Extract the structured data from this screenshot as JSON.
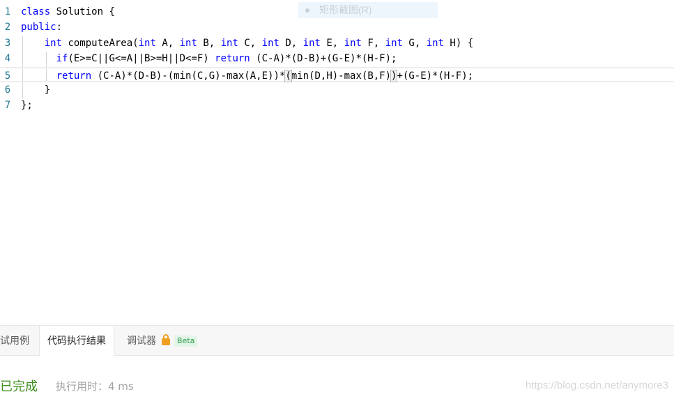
{
  "editor": {
    "line_numbers": [
      "1",
      "2",
      "3",
      "4",
      "5",
      "6",
      "7"
    ],
    "lines": [
      {
        "segments": [
          {
            "t": "class",
            "k": true
          },
          {
            "t": " Solution {",
            "k": false
          }
        ]
      },
      {
        "segments": [
          {
            "t": "public",
            "k": true
          },
          {
            "t": ":",
            "k": false
          }
        ]
      },
      {
        "segments": [
          {
            "t": "    ",
            "k": false
          },
          {
            "t": "int",
            "k": true
          },
          {
            "t": " computeArea(",
            "k": false
          },
          {
            "t": "int",
            "k": true
          },
          {
            "t": " A, ",
            "k": false
          },
          {
            "t": "int",
            "k": true
          },
          {
            "t": " B, ",
            "k": false
          },
          {
            "t": "int",
            "k": true
          },
          {
            "t": " C, ",
            "k": false
          },
          {
            "t": "int",
            "k": true
          },
          {
            "t": " D, ",
            "k": false
          },
          {
            "t": "int",
            "k": true
          },
          {
            "t": " E, ",
            "k": false
          },
          {
            "t": "int",
            "k": true
          },
          {
            "t": " F, ",
            "k": false
          },
          {
            "t": "int",
            "k": true
          },
          {
            "t": " G, ",
            "k": false
          },
          {
            "t": "int",
            "k": true
          },
          {
            "t": " H) {",
            "k": false
          }
        ]
      },
      {
        "segments": [
          {
            "t": "      ",
            "k": false
          },
          {
            "t": "if",
            "k": true
          },
          {
            "t": "(E>=C||G<=A||B>=H||D<=F) ",
            "k": false
          },
          {
            "t": "return",
            "k": true
          },
          {
            "t": " (C-A)*(D-B)+(G-E)*(H-F);",
            "k": false
          }
        ]
      },
      {
        "segments": [
          {
            "t": "      ",
            "k": false
          },
          {
            "t": "return",
            "k": true
          },
          {
            "t": " (C-A)*(D-B)-(min(C,G)-max(A,E))*",
            "k": false
          },
          {
            "t": "(",
            "k": false,
            "b": true
          },
          {
            "t": "min(D,H)-max(B,F)",
            "k": false
          },
          {
            "t": ")",
            "k": false,
            "b": true
          },
          {
            "t": "+(G-E)*(H-F);",
            "k": false
          }
        ]
      },
      {
        "segments": [
          {
            "t": "    }",
            "k": false
          }
        ]
      },
      {
        "segments": [
          {
            "t": "};",
            "k": false
          }
        ]
      }
    ]
  },
  "overlay": {
    "screenshot_hint": "矩形截图(R)"
  },
  "tabs": {
    "testcase_label": "试用例",
    "result_label": "代码执行结果",
    "debugger_label": "调试器",
    "beta_label": "Beta"
  },
  "result": {
    "status": "已完成",
    "exec_time": "执行用时：4 ms",
    "watermark": "https://blog.csdn.net/anymore3"
  },
  "colors": {
    "keyword": "#0000ff",
    "line_number": "#237893",
    "status_green": "#3d8f1e",
    "lock_orange": "#f0a020",
    "beta_green": "#2e9e49"
  },
  "icons": {
    "lock": "lock-icon"
  }
}
